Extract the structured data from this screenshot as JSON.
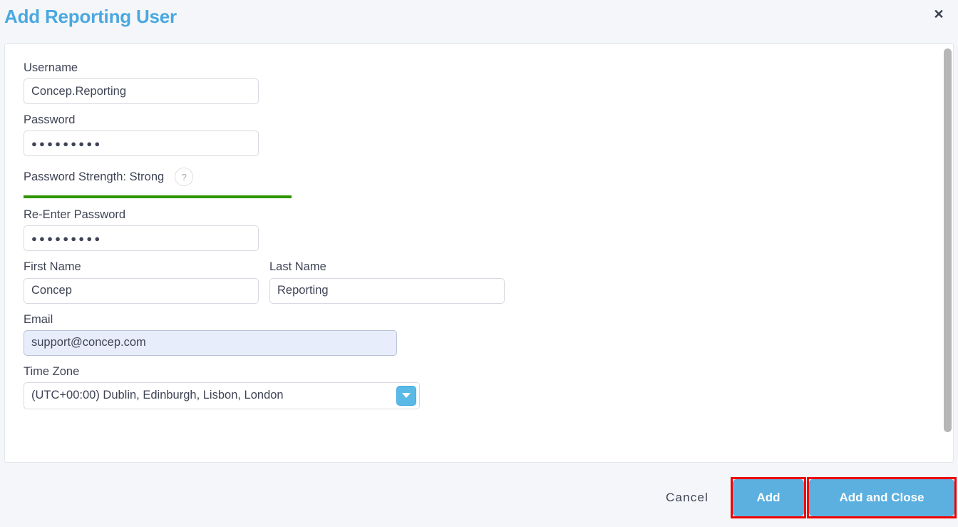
{
  "header": {
    "title": "Add Reporting User",
    "close_label": "✕"
  },
  "form": {
    "username": {
      "label": "Username",
      "value": "Concep.Reporting"
    },
    "password": {
      "label": "Password",
      "value": "●●●●●●●●●"
    },
    "password_strength": {
      "label": "Password Strength: Strong",
      "level": "Strong",
      "help_label": "?",
      "bar_percent": 100,
      "bar_color": "#2e9400"
    },
    "reenter_password": {
      "label": "Re-Enter Password",
      "value": "●●●●●●●●●"
    },
    "first_name": {
      "label": "First Name",
      "value": "Concep"
    },
    "last_name": {
      "label": "Last Name",
      "value": "Reporting"
    },
    "email": {
      "label": "Email",
      "value": "support@concep.com"
    },
    "time_zone": {
      "label": "Time Zone",
      "value": "(UTC+00:00) Dublin, Edinburgh, Lisbon, London"
    }
  },
  "footer": {
    "cancel_label": "Cancel",
    "add_label": "Add",
    "add_and_close_label": "Add and Close"
  },
  "colors": {
    "title_blue": "#4aa8e0",
    "button_blue": "#5bb0e0",
    "strength_green": "#2e9400",
    "highlight_red": "#ee0000",
    "autofill_blue": "#e8edfb"
  }
}
